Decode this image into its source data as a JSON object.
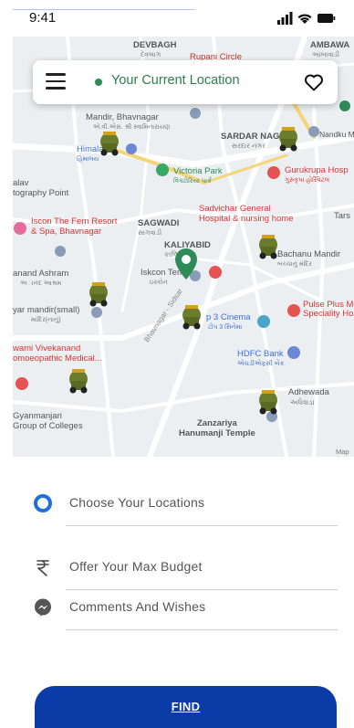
{
  "status": {
    "time": "9:41"
  },
  "search": {
    "current_location": "Your Current Location"
  },
  "map": {
    "attribution": "Map",
    "places": [
      {
        "name": "DEVBAGH",
        "sub": "દેવબાગ"
      },
      {
        "name": "Rupani Circle",
        "sub": ""
      },
      {
        "name": "AMBAWA",
        "sub": "આંબાવાડી"
      },
      {
        "name": "Mandir, Bhavnagar",
        "sub": "એ.વી.એસ. શ્રી સ્વામિનારાયણ"
      },
      {
        "name": "SARDAR NAG",
        "sub": "સરદાર નગર"
      },
      {
        "name": "Nandku Mahila",
        "sub": ""
      },
      {
        "name": "Himalaya",
        "sub": "હિમાલય"
      },
      {
        "name": "Victoria Park",
        "sub": "વિક્ટોરિયા પાર્ક"
      },
      {
        "name": "Gurukrupa Hosp",
        "sub": "ગુરુકૃપા હોસ્પિટલ"
      },
      {
        "name": "alav",
        "sub": "tography Point"
      },
      {
        "name": "Sadvichar General",
        "sub": "Hospital & nursing home"
      },
      {
        "name": "Iscon The Fern Resort",
        "sub": "& Spa, Bhavnagar"
      },
      {
        "name": "SAGWADI",
        "sub": "સાગવાડી"
      },
      {
        "name": "KALIYABID",
        "sub": "કાળિયાબીડ"
      },
      {
        "name": "Tars",
        "sub": ""
      },
      {
        "name": "Bachanu Mandir",
        "sub": "બચ્ચાનું મંદિર"
      },
      {
        "name": "anand Ashram",
        "sub": "અાનંદ આશ્રમ"
      },
      {
        "name": "Iskcon Tem",
        "sub": "ઇસ્કોન"
      },
      {
        "name": "yar mandir(small)",
        "sub": "માંદિર(નાનું)"
      },
      {
        "name": "p 3 Cinema",
        "sub": "ટોપ 3 સિનેમા"
      },
      {
        "name": "Pulse Plus Mu",
        "sub": "Speciality Hos"
      },
      {
        "name": "wami Vivekanand",
        "sub": "omoeopathic Medical..."
      },
      {
        "name": "HDFC Bank",
        "sub": "એચડીએફસી બેંક"
      },
      {
        "name": "Adhewada",
        "sub": "અધેવાડા"
      },
      {
        "name": "Gyanmanjari",
        "sub": "Group of Colleges"
      },
      {
        "name": "Zanzariya",
        "sub": "Hanumanji Temple"
      },
      {
        "name": "Bhavnagar - Sidsar",
        "sub": ""
      }
    ]
  },
  "form": {
    "locations_placeholder": "Choose Your Locations",
    "budget_placeholder": "Offer Your Max Budget",
    "comments_placeholder": "Comments And Wishes",
    "find_label": "FIND"
  },
  "colors": {
    "primary": "#0a3ba6",
    "location_green": "#2e8b57",
    "radio_blue": "#1e6fe0"
  }
}
